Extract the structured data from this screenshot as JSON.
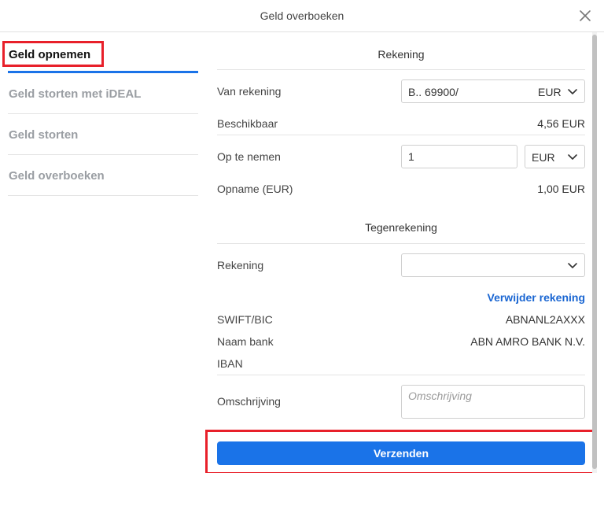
{
  "dialog": {
    "title": "Geld overboeken"
  },
  "sidebar": {
    "items": [
      {
        "label": "Geld opnemen",
        "active": true
      },
      {
        "label": "Geld storten met iDEAL",
        "active": false
      },
      {
        "label": "Geld storten",
        "active": false
      },
      {
        "label": "Geld overboeken",
        "active": false
      }
    ]
  },
  "rekening": {
    "section_title": "Rekening",
    "van_rekening": {
      "label": "Van rekening",
      "value": "B.. 69900/",
      "currency": "EUR"
    },
    "beschikbaar": {
      "label": "Beschikbaar",
      "value": "4,56 EUR"
    },
    "op_te_nemen": {
      "label": "Op te nemen",
      "value": "1",
      "currency": "EUR"
    },
    "opname": {
      "label": "Opname (EUR)",
      "value": "1,00 EUR"
    }
  },
  "tegenrekening": {
    "section_title": "Tegenrekening",
    "rekening": {
      "label": "Rekening",
      "value": ""
    },
    "remove_link": "Verwijder rekening",
    "swift": {
      "label": "SWIFT/BIC",
      "value": "ABNANL2AXXX"
    },
    "naam_bank": {
      "label": "Naam bank",
      "value": "ABN AMRO BANK N.V."
    },
    "iban": {
      "label": "IBAN",
      "value": ""
    }
  },
  "omschrijving": {
    "label": "Omschrijving",
    "placeholder": "Omschrijving",
    "value": ""
  },
  "submit_label": "Verzenden",
  "colors": {
    "accent": "#1a73e8",
    "link": "#1a66d2",
    "highlight": "#e8202a"
  },
  "icons": {
    "close": "close-icon",
    "chevron": "chevron-down-icon"
  }
}
